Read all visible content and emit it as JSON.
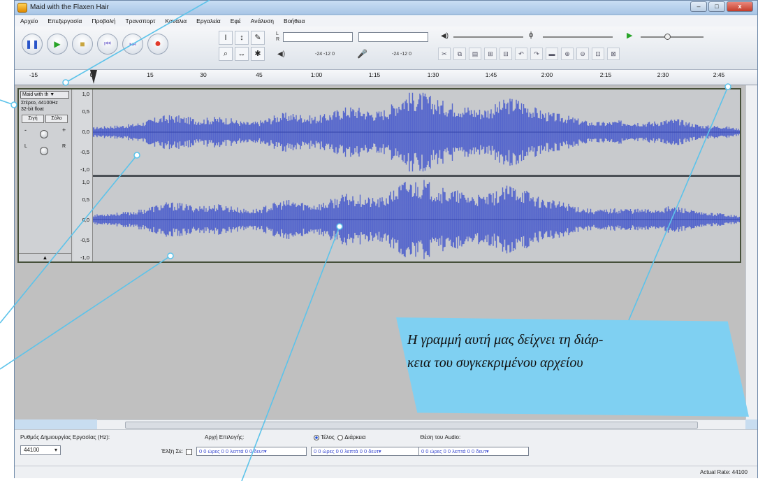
{
  "window": {
    "title": "Maid with the Flaxen Hair",
    "buttons": {
      "minimize": "–",
      "maximize": "□",
      "close": "x"
    }
  },
  "menu": [
    "Αρχείο",
    "Επεξεργασία",
    "Προβολή",
    "Τρανσπορτ",
    "Κανάλια",
    "Εργαλεία",
    "Εφέ",
    "Ανάλυση",
    "Βοήθεια"
  ],
  "transport": {
    "pause": "❚❚",
    "play": "▶",
    "stop": "■",
    "skip_start": "⏮",
    "skip_end": "⏭",
    "record": "●"
  },
  "tools": [
    "I",
    "↕",
    "✎",
    "⌕",
    "↔",
    "✱"
  ],
  "meters": {
    "playback_scale": "-24 -12 0",
    "record_scale": "-24 -12 0",
    "left": "L",
    "right": "R"
  },
  "ruler": {
    "ticks": [
      "-15",
      "0",
      "15",
      "30",
      "45",
      "1:00",
      "1:15",
      "1:30",
      "1:45",
      "2:00",
      "2:15",
      "2:30",
      "2:45"
    ]
  },
  "track": {
    "name": "Maid with th ▼",
    "info_line1": "Στέρεο, 44100Hz",
    "info_line2": "32-bit float",
    "mute": "Σιγή",
    "solo": "Σόλο",
    "gain_minus": "-",
    "gain_plus": "+",
    "pan_left": "L",
    "pan_right": "R",
    "collapse": "▲",
    "scale_ch1": [
      "1,0",
      "0,5",
      "0,0",
      "-0,5",
      "-1,0"
    ],
    "scale_ch2": [
      "1,0",
      "0,5",
      "0,0",
      "-0,5",
      "-1,0"
    ]
  },
  "selection_bar": {
    "rate_label": "Ρυθμός Δημιουργίας Εργασίας (Hz):",
    "rate_value": "44100",
    "snap_label": "Έλξη Σε:",
    "start_label": "Αρχή Επιλογής:",
    "end_label": "Τέλος",
    "length_label": "Διάρκεια",
    "position_label": "Θέση του Audio:",
    "time_value": "0 0 ώρες 0 0 λεπτά 0 0 δευτ▾"
  },
  "status": {
    "rate_text": "Actual Rate: 44100"
  },
  "annotation": {
    "text": "Η γραμμή αυτή μας δείχνει τη διάρκεια του συγκεκριμένου αρχείου",
    "text_line1": "Η γραμμή αυτή μας δείχνει τη διάρ-",
    "text_line2": "κεια του συγκεκριμένου αρχείου",
    "accent_color": "#7fd0f2",
    "line_color": "#5cc3ea"
  },
  "colors": {
    "waveform": "#5566cc",
    "waveform_dark": "#3344aa",
    "track_bg": "#c8cacd"
  }
}
